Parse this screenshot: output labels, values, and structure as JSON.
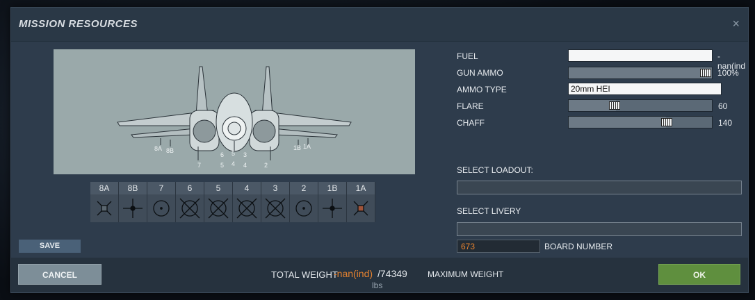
{
  "dialog": {
    "title": "MISSION RESOURCES",
    "close_glyph": "×"
  },
  "stations": [
    {
      "id": "8A",
      "icon": "fuel-tank-cross-icon"
    },
    {
      "id": "8B",
      "icon": "rail-pylon-icon"
    },
    {
      "id": "7",
      "icon": "empty-circle-icon"
    },
    {
      "id": "6",
      "icon": "bomb-rack-icon"
    },
    {
      "id": "5",
      "icon": "bomb-rack-icon"
    },
    {
      "id": "4",
      "icon": "bomb-rack-icon"
    },
    {
      "id": "3",
      "icon": "bomb-rack-icon"
    },
    {
      "id": "2",
      "icon": "empty-circle-icon"
    },
    {
      "id": "1B",
      "icon": "rail-pylon-icon"
    },
    {
      "id": "1A",
      "icon": "fuel-tank-cross-icon"
    }
  ],
  "preview_labels": {
    "l8a": "8A",
    "l8b": "8B",
    "l7": "7",
    "l6": "6",
    "l5a": "5",
    "l5b": "5",
    "l4a": "4",
    "l4b": "4",
    "l3": "3",
    "l2": "2",
    "l1b": "1B",
    "l1a": "1A"
  },
  "save_label": "SAVE",
  "resources": {
    "fuel": {
      "label": "FUEL",
      "value": "-nan(ind"
    },
    "gun_ammo": {
      "label": "GUN AMMO",
      "value": "100%",
      "level": 1.0
    },
    "ammo_type": {
      "label": "AMMO TYPE",
      "value": "20mm HEI"
    },
    "flare": {
      "label": "FLARE",
      "value": "60",
      "level": 0.33
    },
    "chaff": {
      "label": "CHAFF",
      "value": "140",
      "level": 0.68
    }
  },
  "loadout": {
    "label": "SELECT LOADOUT:",
    "value": ""
  },
  "livery": {
    "label": "SELECT LIVERY",
    "value": ""
  },
  "board_number": {
    "value": "673",
    "label": "BOARD NUMBER"
  },
  "footer": {
    "cancel_label": "CANCEL",
    "ok_label": "OK",
    "total_weight_label": "TOTAL WEIGHT",
    "total_weight_value": "-nan(ind)",
    "total_weight_separator": "/",
    "max_weight_value": "74349",
    "weight_unit": "lbs",
    "max_weight_label": "MAXIMUM WEIGHT"
  },
  "colors": {
    "accent_orange": "#e5822f",
    "ok_green": "#5f8f3e",
    "panel": "#2e3c4c"
  }
}
